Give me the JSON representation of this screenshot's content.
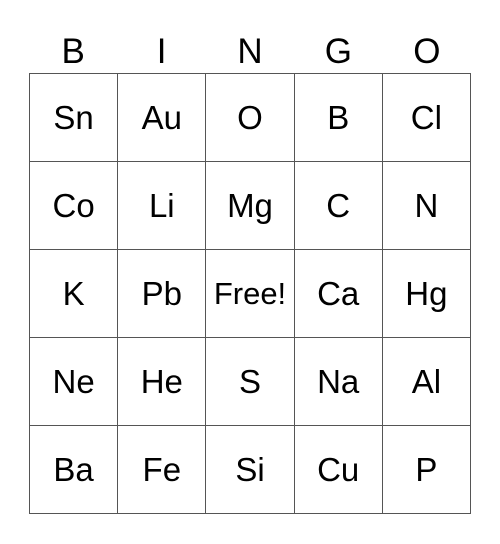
{
  "header": [
    "B",
    "I",
    "N",
    "G",
    "O"
  ],
  "rows": [
    [
      "Sn",
      "Au",
      "O",
      "B",
      "Cl"
    ],
    [
      "Co",
      "Li",
      "Mg",
      "C",
      "N"
    ],
    [
      "K",
      "Pb",
      "Free!",
      "Ca",
      "Hg"
    ],
    [
      "Ne",
      "He",
      "S",
      "Na",
      "Al"
    ],
    [
      "Ba",
      "Fe",
      "Si",
      "Cu",
      "P"
    ]
  ]
}
